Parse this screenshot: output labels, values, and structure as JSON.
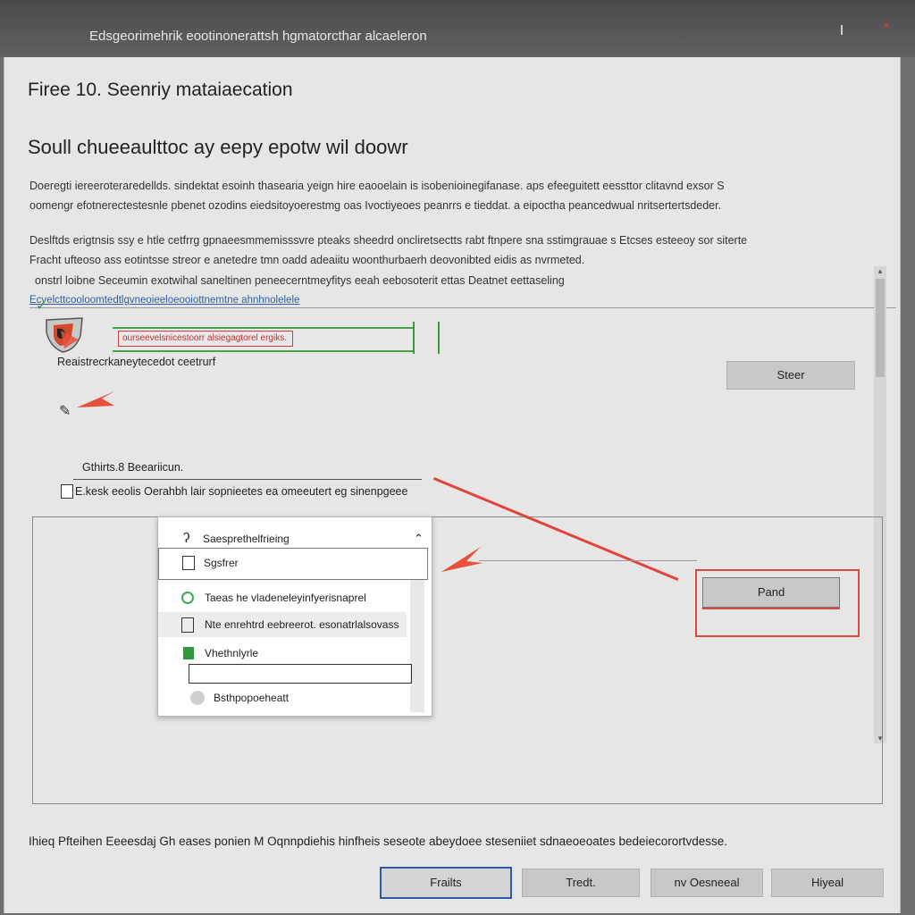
{
  "window": {
    "title": "Edsgeorimehrik eootinonerattsh hgmatorcthar alcaeleron",
    "controls": {
      "minimize": "I",
      "close": "×"
    }
  },
  "header": {
    "title": "Firee 10. Seenriy mataiaecation",
    "subtitle": "Soull chueeaulttoc ay eepy epotw wil doowr"
  },
  "description": {
    "paragraph1_line1": "Doeregti iereeroteraredellds. sindektat esoinh thasearia yeign hire eaooelain is isobenioinegifanase. aps efeeguitett eessttor clitavnd exsor S",
    "paragraph1_line2": "oomengr efotnerectestesnle pbenet ozodins eiedsitoyoerestmg oas Ivoctiyeoes peanrrs e tieddat. a eipoctha peancedwual nritsertertsdeder.",
    "paragraph2_line1": "Deslftds erigtnsis ssy e htle cetfrrg gpnaeesmmemisssvre pteaks sheedrd oncliretsectts rabt ftnpere sna sstimgrauae s Etcses esteeoy sor siterte",
    "paragraph2_line2": "Fracht ufteoso ass eotintsse streor e anetedre tmn oadd adeaiitu woonthurbaerh deovonibted eidis as nvrmeted.",
    "paragraph2_line3": "onstrl loibne Seceumin exotwihal saneltinen peneecerntmeyfitys eeah eebosoterit ettas Deatnet eettaseling",
    "link": "Ecvelcttcooloomtedtlgvneoieeloeooiottnemtne ahnhnolelele"
  },
  "security": {
    "section_label": "Reaistrecrkaneytecedot ceetrurf",
    "path_value": "ourseevelsnicestoorr alsiegagtorel ergiks.",
    "scan_button": "Steer"
  },
  "options": {
    "label": "Gthirts.8 Beeariicun.",
    "checkbox_label": "E.kesk eeolis Oerahbh lair sopnieetes ea omeeutert eg sinenpgeee"
  },
  "dropdown": {
    "header": "Saesprethelfrieing",
    "search_value": "Sgsfrer",
    "items": [
      {
        "icon": "green-circle-icon",
        "label": "Taeas he vladeneleyinfyerisnaprel"
      },
      {
        "icon": "document-icon",
        "label": "Nte enrehtrd eebreerot. esonatrlalsovass"
      },
      {
        "icon": "green-flag-icon",
        "label": "Vhethnlyrle"
      },
      {
        "icon": "gray-circle-icon",
        "label": "Bsthpopoeheatt"
      }
    ]
  },
  "callout": {
    "button_label": "Pand"
  },
  "footer": {
    "text": "Ihieq Pfteihen Eeeesdaj Gh eases ponien M Oqnnpdiehis hinfheis seseote abeydoee steseniiet sdnaeoeoates bedeiecorortvdesse.",
    "buttons": [
      "Frailts",
      "Tredt.",
      "nv Oesneeal",
      "Hiyeal"
    ]
  },
  "colors": {
    "accent_red": "#e0443c",
    "accent_green": "#3a9a3a",
    "primary_button_border": "#2a5aa8"
  }
}
